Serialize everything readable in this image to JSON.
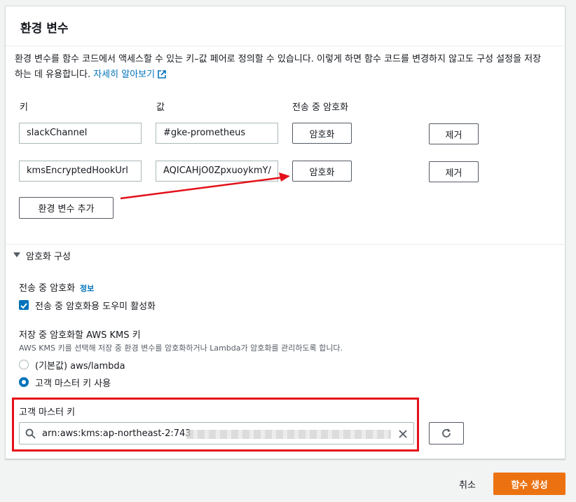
{
  "panel": {
    "title": "환경 변수",
    "description": "환경 변수를 함수 코드에서 액세스할 수 있는 키–값 페어로 정의할 수 있습니다. 이렇게 하면 함수 코드를 변경하지 않고도 구성 설정을 저장하는 데 유용합니다.",
    "learn_more": "자세히 알아보기"
  },
  "env_table": {
    "col_key": "키",
    "col_value": "값",
    "col_encrypt": "전송 중 암호화",
    "rows": [
      {
        "key": "slackChannel",
        "value": "#gke-prometheus",
        "encrypt_label": "암호화",
        "remove_label": "제거"
      },
      {
        "key": "kmsEncryptedHookUrl",
        "value": "AQICAHjO0ZpxuoykmY/",
        "encrypt_label": "암호화",
        "remove_label": "제거"
      }
    ],
    "add_label": "환경 변수 추가"
  },
  "encryption_config": {
    "section_label": "암호화 구성",
    "transit_label": "전송 중 암호화",
    "info_link": "정보",
    "transit_checkbox_label": "전송 중 암호화용 도우미 활성화",
    "transit_checked": true,
    "kms_label": "저장 중 암호화할 AWS KMS 키",
    "kms_description": "AWS KMS 키를 선택해 저장 중 환경 변수를 암호화하거나 Lambda가 암호화를 관리하도록 합니다.",
    "options": [
      {
        "label": "(기본값) aws/lambda",
        "selected": false
      },
      {
        "label": "고객 마스터 키 사용",
        "selected": true
      }
    ],
    "cmk_label": "고객 마스터 키",
    "cmk_value": "arn:aws:kms:ap-northeast-2:743"
  },
  "footer": {
    "cancel_label": "취소",
    "create_label": "함수 생성"
  },
  "colors": {
    "link": "#0073bb",
    "primary": "#ec7211",
    "annotation": "#e4101a"
  },
  "icons": {
    "external": "external-link-icon",
    "caret": "caret-down-icon",
    "search": "search-icon",
    "clear": "close-icon",
    "refresh": "refresh-icon"
  }
}
